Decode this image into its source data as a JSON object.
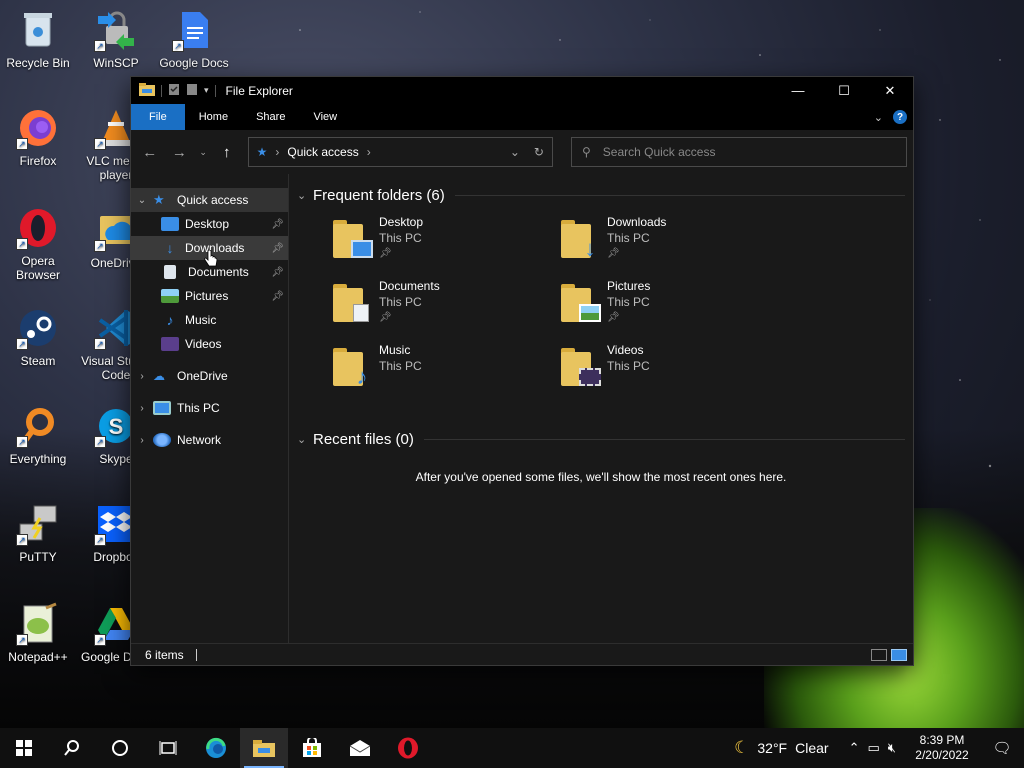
{
  "desktop": {
    "icons": [
      {
        "label": "Recycle Bin",
        "icon": "recycle-bin-icon"
      },
      {
        "label": "WinSCP",
        "icon": "winscp-icon"
      },
      {
        "label": "Google Docs",
        "icon": "google-docs-icon"
      },
      {
        "label": "Firefox",
        "icon": "firefox-icon"
      },
      {
        "label": "VLC media player",
        "icon": "vlc-icon"
      },
      {
        "label": "OneDrive",
        "icon": "onedrive-icon"
      },
      {
        "label": "Opera Browser",
        "icon": "opera-icon"
      },
      {
        "label": "Steam",
        "icon": "steam-icon"
      },
      {
        "label": "Visual Studio Code",
        "icon": "vscode-icon"
      },
      {
        "label": "Everything",
        "icon": "everything-icon"
      },
      {
        "label": "Skype",
        "icon": "skype-icon"
      },
      {
        "label": "PuTTY",
        "icon": "putty-icon"
      },
      {
        "label": "Dropbox",
        "icon": "dropbox-icon"
      },
      {
        "label": "Notepad++",
        "icon": "notepadpp-icon"
      },
      {
        "label": "Google Drive",
        "icon": "google-drive-icon"
      }
    ]
  },
  "window": {
    "title": "File Explorer",
    "ribbon_tabs": [
      "File",
      "Home",
      "Share",
      "View"
    ],
    "address": "Quick access",
    "search_placeholder": "Search Quick access",
    "nav": {
      "quick_access": "Quick access",
      "items": [
        "Desktop",
        "Downloads",
        "Documents",
        "Pictures",
        "Music",
        "Videos"
      ],
      "onedrive": "OneDrive",
      "this_pc": "This PC",
      "network": "Network"
    },
    "frequent_header": "Frequent folders (6)",
    "folders": [
      {
        "name": "Desktop",
        "location": "This PC",
        "pinned": true
      },
      {
        "name": "Downloads",
        "location": "This PC",
        "pinned": true
      },
      {
        "name": "Documents",
        "location": "This PC",
        "pinned": true
      },
      {
        "name": "Pictures",
        "location": "This PC",
        "pinned": true
      },
      {
        "name": "Music",
        "location": "This PC",
        "pinned": false
      },
      {
        "name": "Videos",
        "location": "This PC",
        "pinned": false
      }
    ],
    "recent_header": "Recent files (0)",
    "recent_message": "After you've opened some files, we'll show the most recent ones here.",
    "status_items": "6 items"
  },
  "taskbar": {
    "weather_temp": "32°F",
    "weather_desc": "Clear",
    "time": "8:39 PM",
    "date": "2/20/2022"
  },
  "colors": {
    "accent": "#1a6fc4",
    "folder": "#e8c45f",
    "window_bg": "#191919"
  }
}
